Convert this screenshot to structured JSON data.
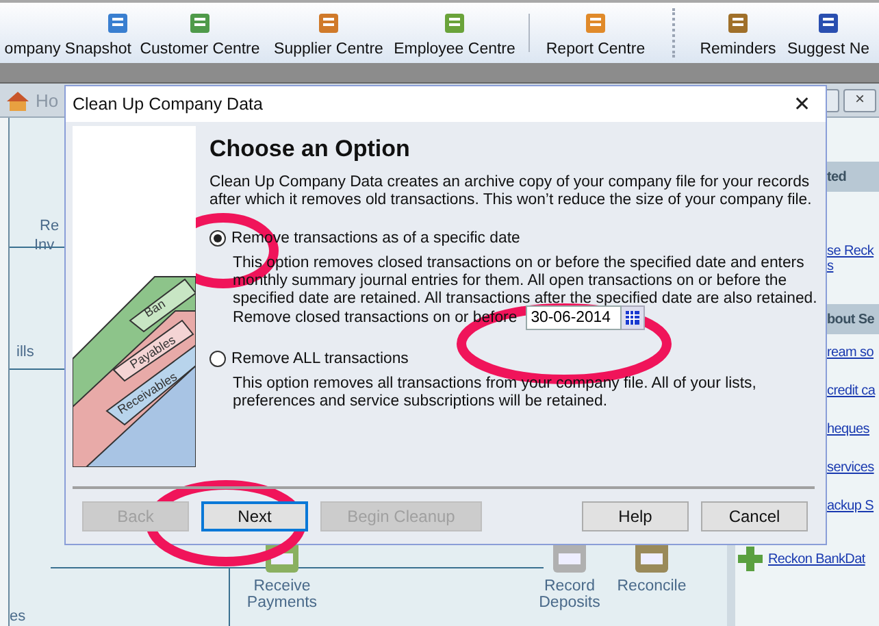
{
  "toolbar": [
    {
      "label": "ompany Snapshot",
      "kind": "snapshot"
    },
    {
      "label": "Customer Centre",
      "kind": "customer"
    },
    {
      "label": "Supplier Centre",
      "kind": "supplier"
    },
    {
      "label": "Employee Centre",
      "kind": "employee"
    },
    {
      "label": "Report Centre",
      "kind": "report"
    },
    {
      "label": "Reminders",
      "kind": "reminders"
    },
    {
      "label": "Suggest Ne",
      "kind": "suggest"
    }
  ],
  "home_window": {
    "title": "Ho",
    "window_close": "×",
    "left_labels": [
      "Re",
      "Inv",
      "ills",
      "es"
    ],
    "flow_items": [
      {
        "label": "Receive Payments",
        "kind": "payments"
      },
      {
        "label": "Record Deposits",
        "kind": "deposits"
      },
      {
        "label": "Reconcile",
        "kind": "reconcile"
      }
    ],
    "sidebar": {
      "headers": [
        "ted",
        "bout Se"
      ],
      "links": [
        "se Reck",
        "s",
        "ream so",
        "credit ca",
        "heques",
        "services",
        "ackup S"
      ],
      "bottom_link": "Reckon BankDat"
    }
  },
  "dialog": {
    "title": "Clean Up Company Data",
    "close": "✕",
    "folder_tabs": [
      "Ban",
      "Payables",
      "Receivables"
    ],
    "heading": "Choose an Option",
    "intro": "Clean Up Company Data creates an archive copy of your company file for your records after which it removes old transactions. This won’t reduce the size of your company file.",
    "options": [
      {
        "label": "Remove transactions as of a specific date",
        "selected": true,
        "description": "This option removes closed transactions on or before the specified date and enters monthly summary journal entries for them.  All open transactions on or before the specified date are retained.  All transactions after the specified date are also retained.",
        "date_label": "Remove closed transactions on or before",
        "date_value": "30-06-2014"
      },
      {
        "label": "Remove ALL transactions",
        "selected": false,
        "description": "This option removes all transactions from your company file.  All of your lists, preferences and service subscriptions will be retained."
      }
    ],
    "buttons": [
      {
        "label": "Back",
        "disabled": true,
        "focused": false
      },
      {
        "label": "Next",
        "disabled": false,
        "focused": true
      },
      {
        "label": "Begin Cleanup",
        "disabled": true,
        "focused": false
      },
      {
        "label": "Help",
        "disabled": false,
        "focused": false
      },
      {
        "label": "Cancel",
        "disabled": false,
        "focused": false
      }
    ]
  }
}
